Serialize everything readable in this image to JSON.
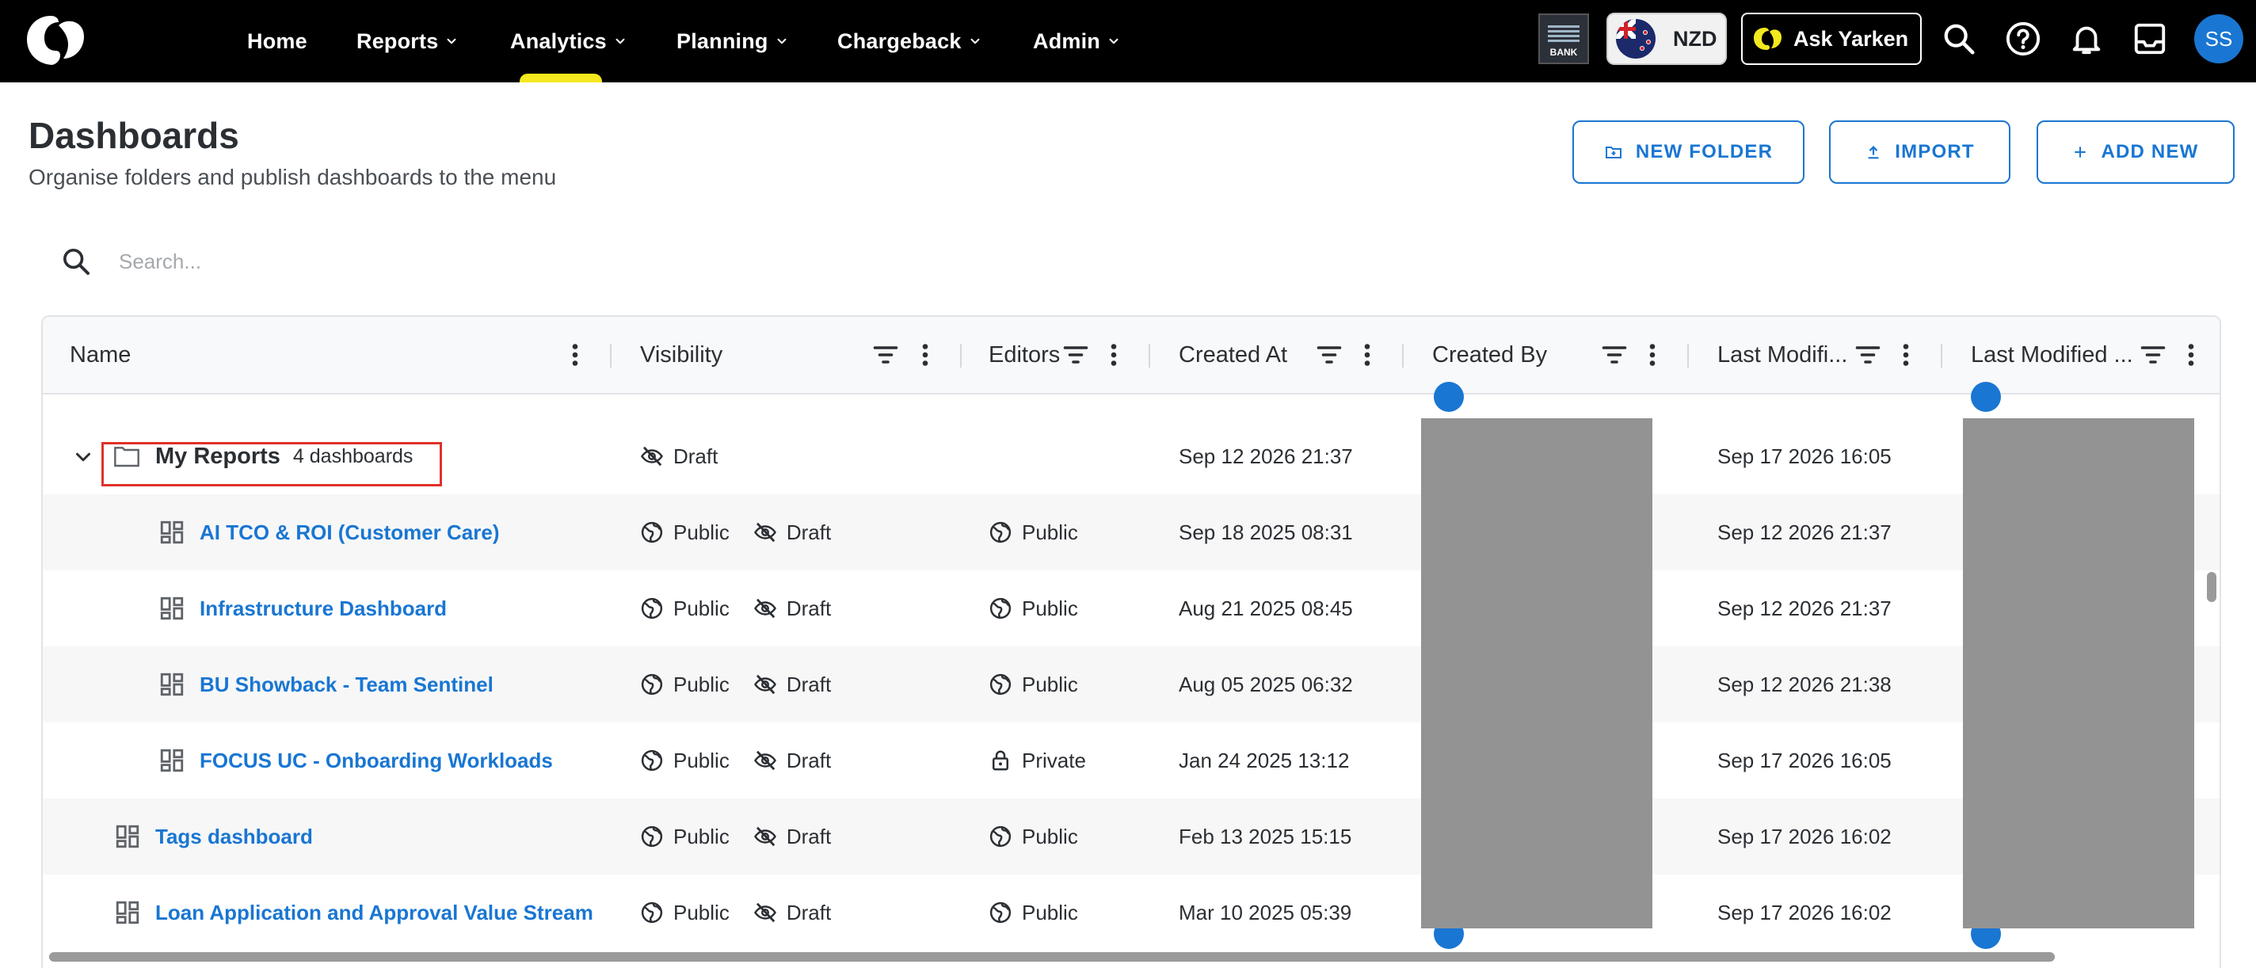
{
  "nav": {
    "items": [
      {
        "label": "Home",
        "has_menu": false
      },
      {
        "label": "Reports",
        "has_menu": true
      },
      {
        "label": "Analytics",
        "has_menu": true,
        "active": true
      },
      {
        "label": "Planning",
        "has_menu": true
      },
      {
        "label": "Chargeback",
        "has_menu": true
      },
      {
        "label": "Admin",
        "has_menu": true
      }
    ],
    "bank_tile_label": "BANK",
    "currency": "NZD",
    "ask_label": "Ask Yarken",
    "avatar_initials": "SS",
    "accent_color": "#f4e81e"
  },
  "page": {
    "title": "Dashboards",
    "subtitle": "Organise folders and publish dashboards to the menu",
    "buttons": {
      "new_folder": "NEW FOLDER",
      "import": "IMPORT",
      "add_new": "ADD NEW"
    }
  },
  "search": {
    "placeholder": "Search..."
  },
  "grid": {
    "columns": {
      "name": "Name",
      "visibility": "Visibility",
      "editors": "Editors",
      "created_at": "Created At",
      "created_by": "Created By",
      "last_modified_at": "Last Modifi...",
      "last_modified_by": "Last Modified ..."
    },
    "folder": {
      "name": "My Reports",
      "count": "4 dashboards",
      "visibility": "Draft",
      "created_at": "Sep 12 2026 21:37",
      "last_modified": "Sep 17 2026 16:05"
    },
    "rows": [
      {
        "name": "AI TCO & ROI (Customer Care)",
        "nested": true,
        "visibility": "Public",
        "status": "Draft",
        "editors": "Public",
        "editors_icon": "globe-icon",
        "created_at": "Sep 18 2025 08:31",
        "last_modified": "Sep 12 2026 21:37"
      },
      {
        "name": "Infrastructure Dashboard",
        "nested": true,
        "visibility": "Public",
        "status": "Draft",
        "editors": "Public",
        "editors_icon": "globe-icon",
        "created_at": "Aug 21 2025 08:45",
        "last_modified": "Sep 12 2026 21:37"
      },
      {
        "name": "BU Showback - Team Sentinel",
        "nested": true,
        "visibility": "Public",
        "status": "Draft",
        "editors": "Public",
        "editors_icon": "globe-icon",
        "created_at": "Aug 05 2025 06:32",
        "last_modified": "Sep 12 2026 21:38"
      },
      {
        "name": "FOCUS UC - Onboarding Workloads",
        "nested": true,
        "visibility": "Public",
        "status": "Draft",
        "editors": "Private",
        "editors_icon": "lock-icon",
        "created_at": "Jan 24 2025 13:12",
        "last_modified": "Sep 17 2026 16:05"
      },
      {
        "name": "Tags dashboard",
        "nested": false,
        "visibility": "Public",
        "status": "Draft",
        "editors": "Public",
        "editors_icon": "globe-icon",
        "created_at": "Feb 13 2025 15:15",
        "last_modified": "Sep 17 2026 16:02"
      },
      {
        "name": "Loan Application and Approval Value Stream",
        "nested": false,
        "visibility": "Public",
        "status": "Draft",
        "editors": "Public",
        "editors_icon": "globe-icon",
        "created_at": "Mar 10 2025 05:39",
        "last_modified": "Sep 17 2026 16:02"
      }
    ]
  }
}
